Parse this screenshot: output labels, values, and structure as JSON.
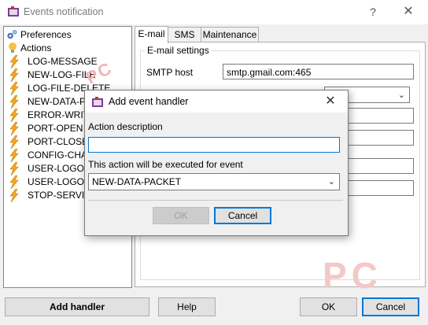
{
  "window": {
    "title": "Events notification",
    "help": "?",
    "close": "✕"
  },
  "tree": {
    "root_items": [
      {
        "label": "Preferences",
        "icon": "gears-icon"
      },
      {
        "label": "Actions",
        "icon": "lightbulb-icon"
      }
    ],
    "actions": [
      "LOG-MESSAGE",
      "NEW-LOG-FILE",
      "LOG-FILE-DELETE",
      "NEW-DATA-PA",
      "ERROR-WRITI",
      "PORT-OPEN",
      "PORT-CLOSE",
      "CONFIG-CHAN",
      "USER-LOGOFF",
      "USER-LOGON",
      "STOP-SERVIC"
    ]
  },
  "tabs": [
    "E-mail",
    "SMS",
    "Maintenance"
  ],
  "email_settings": {
    "group_label": "E-mail settings",
    "smtp_label": "SMTP host",
    "smtp_value": "smtp.gmail.com:465"
  },
  "dialog": {
    "title": "Add event handler",
    "close": "✕",
    "description_label": "Action description",
    "description_value": "",
    "event_label": "This action will be executed for event",
    "event_value": "NEW-DATA-PACKET",
    "ok": "OK",
    "cancel": "Cancel"
  },
  "footer": {
    "add_handler": "Add handler",
    "help": "Help",
    "ok": "OK",
    "cancel": "Cancel"
  },
  "watermark": {
    "small": "PC",
    "large": "PC"
  },
  "colors": {
    "accent": "#0078d7",
    "bolt": "#f5a623"
  }
}
